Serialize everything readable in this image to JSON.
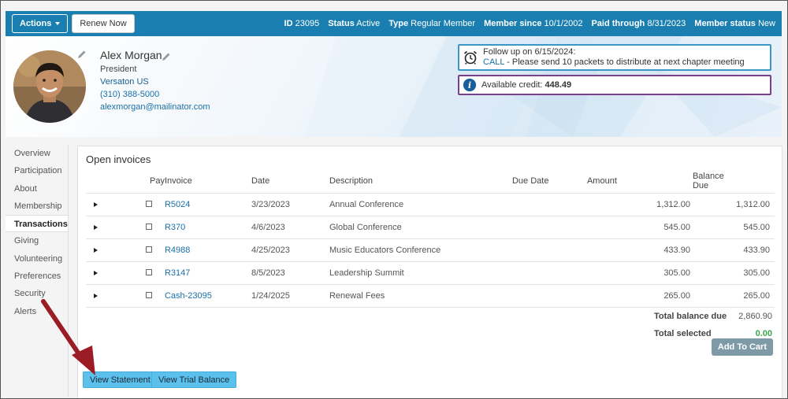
{
  "topbar": {
    "actions_label": "Actions",
    "renew_label": "Renew Now",
    "meta": [
      {
        "label": "ID",
        "value": "23095"
      },
      {
        "label": "Status",
        "value": "Active"
      },
      {
        "label": "Type",
        "value": "Regular Member"
      },
      {
        "label": "Member since",
        "value": "10/1/2002"
      },
      {
        "label": "Paid through",
        "value": "8/31/2023"
      },
      {
        "label": "Member status",
        "value": "New"
      }
    ]
  },
  "profile": {
    "name": "Alex Morgan",
    "title": "President",
    "organization": "Versaton US",
    "phone": "(310) 388-5000",
    "email": "alexmorgan@mailinator.com"
  },
  "notes": {
    "followup_prefix": "Follow up on ",
    "followup_date": "6/15/2024:",
    "call_label": "CALL",
    "call_text": " - Please send 10 packets to distribute at next chapter meeting",
    "credit_label": "Available credit: ",
    "credit_value": "448.49"
  },
  "sidebar": {
    "items": [
      {
        "label": "Overview"
      },
      {
        "label": "Participation"
      },
      {
        "label": "About"
      },
      {
        "label": "Membership"
      },
      {
        "label": "Transactions"
      },
      {
        "label": "Giving"
      },
      {
        "label": "Volunteering"
      },
      {
        "label": "Preferences"
      },
      {
        "label": "Security"
      },
      {
        "label": "Alerts"
      }
    ],
    "active": "Transactions"
  },
  "invoices": {
    "title": "Open invoices",
    "columns": {
      "pay": "Pay",
      "invoice": "Invoice",
      "date": "Date",
      "description": "Description",
      "due_date": "Due Date",
      "amount": "Amount",
      "balance": "Balance Due"
    },
    "rows": [
      {
        "invoice": "R5024",
        "date": "3/23/2023",
        "description": "Annual Conference",
        "due_date": "",
        "amount": "1,312.00",
        "balance": "1,312.00"
      },
      {
        "invoice": "R370",
        "date": "4/6/2023",
        "description": "Global Conference",
        "due_date": "",
        "amount": "545.00",
        "balance": "545.00"
      },
      {
        "invoice": "R4988",
        "date": "4/25/2023",
        "description": "Music Educators Conference",
        "due_date": "",
        "amount": "433.90",
        "balance": "433.90"
      },
      {
        "invoice": "R3147",
        "date": "8/5/2023",
        "description": "Leadership Summit",
        "due_date": "",
        "amount": "305.00",
        "balance": "305.00"
      },
      {
        "invoice": "Cash-23095",
        "date": "1/24/2025",
        "description": "Renewal Fees",
        "due_date": "",
        "amount": "265.00",
        "balance": "265.00"
      }
    ],
    "total_balance_label": "Total balance due",
    "total_balance_value": "2,860.90",
    "total_selected_label": "Total selected",
    "total_selected_value": "0.00",
    "add_to_cart_label": "Add To Cart"
  },
  "buttons": {
    "view_statement": "View Statement",
    "view_trial_balance": "View Trial Balance"
  },
  "colors": {
    "topbar": "#1a7fb0",
    "link": "#1a6fa8",
    "annotation_arrow": "#9b1c24",
    "button_blue": "#5bc0eb"
  }
}
